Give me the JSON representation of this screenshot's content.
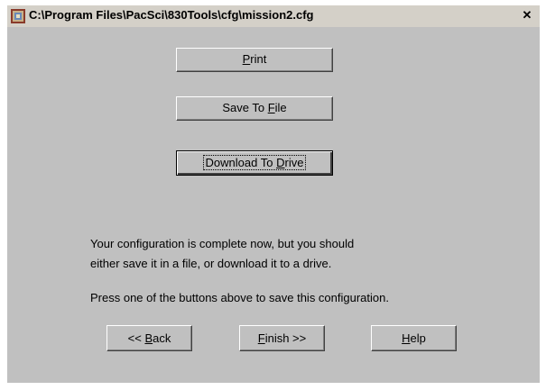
{
  "window": {
    "title": "C:\\Program Files\\PacSci\\830Tools\\cfg\\mission2.cfg",
    "close_label": "✕"
  },
  "actions": {
    "print_prefix": "",
    "print_mnemonic": "P",
    "print_suffix": "rint",
    "save_prefix": "Save To ",
    "save_mnemonic": "F",
    "save_suffix": "ile",
    "download_prefix": "Download To ",
    "download_mnemonic": "D",
    "download_suffix": "rive"
  },
  "message": {
    "line1": "Your configuration is complete now, but you should",
    "line2": "either save it in a file, or download it to a drive.",
    "line3": "Press one of the buttons above to save this configuration."
  },
  "nav": {
    "back_prefix": "<< ",
    "back_mnemonic": "B",
    "back_suffix": "ack",
    "finish_prefix": "",
    "finish_mnemonic": "F",
    "finish_suffix": "inish >>",
    "help_prefix": "",
    "help_mnemonic": "H",
    "help_suffix": "elp"
  }
}
